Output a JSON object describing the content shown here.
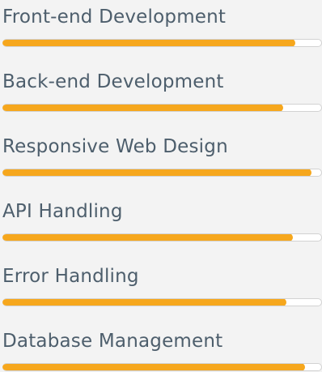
{
  "colors": {
    "background": "#f3f3f3",
    "text": "#4d5e6c",
    "bar_fill": "#f6a71d",
    "bar_track": "#ffffff"
  },
  "skills": [
    {
      "name": "Front-end Development",
      "level": 92
    },
    {
      "name": "Back-end Development",
      "level": 88
    },
    {
      "name": "Responsive Web Design",
      "level": 97
    },
    {
      "name": "API Handling",
      "level": 91
    },
    {
      "name": "Error Handling",
      "level": 89
    },
    {
      "name": "Database Management",
      "level": 95
    }
  ]
}
